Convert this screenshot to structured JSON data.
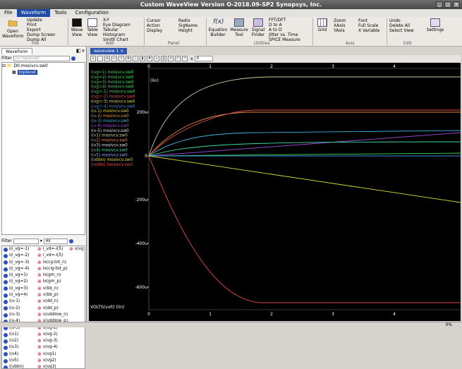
{
  "window": {
    "title": "Custom WaveView Version O-2018.09-SP2 Synopsys, Inc."
  },
  "menu": [
    "File",
    "Waveform",
    "Tools",
    "Configuration"
  ],
  "ribbon": {
    "open_waveform": "Open Waveform",
    "file_list": [
      "Update",
      "Print",
      "Export",
      "Dump Screen",
      "Dump All"
    ],
    "file_group": "File",
    "wave_view": "Wave View",
    "table_view": "Table View",
    "add_list": [
      "X-Y",
      "Eye Diagram",
      "Tabular",
      "Histogram",
      "Smith Chart"
    ],
    "add_group": "Add",
    "panel_list": [
      "Cursor",
      "Action",
      "Display"
    ],
    "panel_list2": [
      "Radix",
      "SigName",
      "Height"
    ],
    "panel_group": "Panel",
    "equation_builder": "Equation Builder",
    "measure_tool": "Measure Tool",
    "signal_finder": "Signal Finder",
    "utilities_list": [
      "FFT/DFT",
      "D to A",
      "A to D",
      "Jitter vs. Time",
      "SPICE Measure"
    ],
    "utilities_group": "Utilities",
    "grid": "Grid",
    "axis_list": [
      "Zoom",
      "XAxis",
      "YAxis"
    ],
    "axis_list2": [
      "Font",
      "Full Scale",
      "X Variable"
    ],
    "axis_group": "Axis",
    "edit_list": [
      "Undo",
      "Delete All",
      "Select View"
    ],
    "edit_group": "Edit",
    "settings": "Settings"
  },
  "left_panel": {
    "tab": "WaveForm",
    "filter_label": "Filter",
    "filter_placeholder": "(or toplevel)",
    "tree": [
      "D0:mosivcv.sw0",
      "toplevel"
    ],
    "filter2_label": "Filter",
    "filter2_value": "All",
    "signals_left": [
      "i(i_vg=-1)",
      "i(i_vg=-2)",
      "i(i_vg=-3)",
      "i(i_vg=-4)",
      "i(i_vg=1)",
      "i(i_vg=2)",
      "i(i_vg=3)",
      "i(i_vg=4)",
      "i(v-1)",
      "i(v-2)",
      "i(v-3)",
      "i(v-4)",
      "i(v-5)",
      "i(v1)",
      "i(v2)",
      "i(v3)",
      "i(v4)",
      "i(v5)",
      "i(vbbn)",
      "i(vddn)"
    ],
    "signals_right": [
      "i_vd=-i(5)",
      "i_vd=-i(5)",
      "lx(cg-tot_n)",
      "lx(cig-tot_p)",
      "lx(gm_n)",
      "lx(gm_p)",
      "v(bb_n)",
      "v(bb_p)",
      "v(dd_n)",
      "v(dd_p)",
      "v(vddlow_n)",
      "v(vddlow_p)",
      "v(vg-1)",
      "v(vg-2)",
      "v(vg-3)",
      "v(vg-4)",
      "v(vg1)",
      "v(vg2)",
      "v(vg3)"
    ],
    "signals_right_top": "v(vg"
  },
  "wave": {
    "tab": "waveview 1",
    "y_unit": "(lin)",
    "y_ticks": [
      "200u",
      "0",
      "-200u",
      "-400u",
      "-600u"
    ],
    "x_ticks_top": [
      "0",
      "1",
      "2",
      "3",
      "4"
    ],
    "x_ticks_bottom": [
      "0",
      "1",
      "2",
      "3",
      "4"
    ],
    "x_label": "VOLTS(volt) (lin)",
    "legend": [
      "i(vg=1) mosivcv.sw0",
      "i(vg=2) mosivcv.sw0",
      "i(vg=3) mosivcv.sw0",
      "i(vg=4) mosivcv.sw0",
      "i(vg=-1) mosivcv.sw0",
      "i(vg=-2) mosivcv.sw0",
      "i(vg=-3) mosivcv.sw0",
      "i(vg=-4) mosivcv.sw0",
      "i(v-1) mosivcv.sw0",
      "i(v-2) mosivcv.sw0",
      "i(v-3) mosivcv.sw0",
      "i(v-4) mosivcv.sw0",
      "i(v-5) mosivcv.sw0",
      "i(v1) mosivcv.sw0",
      "i(v2) mosivcv.sw0",
      "i(v3) mosivcv.sw0",
      "i(v4) mosivcv.sw0",
      "i(v5) mosivcv.sw0",
      "i(vbbn) mosivcv.sw0",
      "i(vddn) mosivcv.sw0"
    ],
    "legend_colors": [
      "#3cdc5a",
      "#3cdc5a",
      "#3cdc5a",
      "#3cdc5a",
      "#3cdc5a",
      "#e64c4c",
      "#dcdc3c",
      "#3c8cdc",
      "#dcdc3c",
      "#e09a3c",
      "#3cb4dc",
      "#a04cdc",
      "#e0e0e0",
      "#d0c898",
      "#e68c4c",
      "#e0e0e0",
      "#3cdca0",
      "#a0a0ff",
      "#dcdc3c",
      "#e64c4c"
    ],
    "x_cursor_value": "0"
  },
  "status": {
    "zoom": "0%"
  }
}
